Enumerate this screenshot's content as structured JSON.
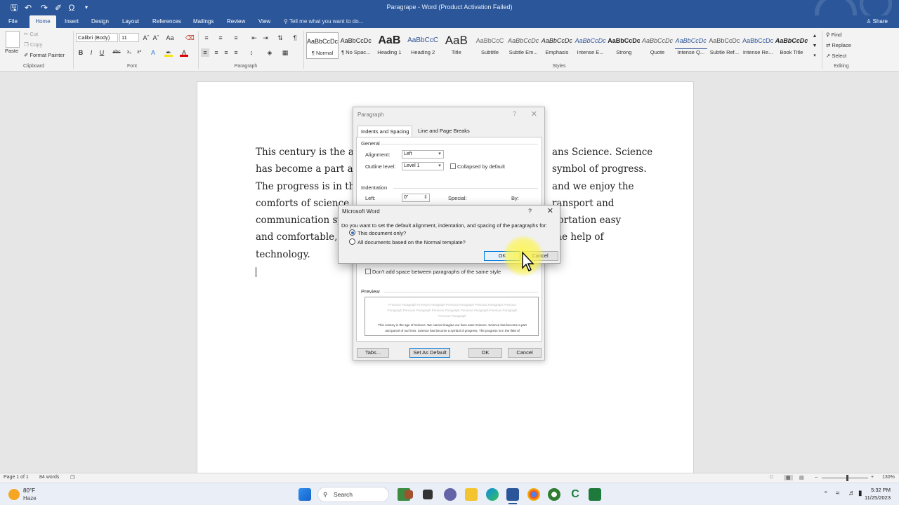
{
  "window": {
    "title": "Paragrape - Word (Product Activation Failed)"
  },
  "tabs": [
    "File",
    "Home",
    "Insert",
    "Design",
    "Layout",
    "References",
    "Mailings",
    "Review",
    "View"
  ],
  "tell_me": "Tell me what you want to do...",
  "share_label": "Share",
  "clipboard": {
    "paste": "Paste",
    "cut": "Cut",
    "copy": "Copy",
    "format_painter": "Format Painter",
    "label": "Clipboard"
  },
  "font": {
    "name": "Calibri (Body)",
    "size": "11",
    "label": "Font"
  },
  "paragraph_group_label": "Paragraph",
  "styles": {
    "label": "Styles",
    "items": [
      {
        "preview": "AaBbCcDc",
        "name": "¶ Normal"
      },
      {
        "preview": "AaBbCcDc",
        "name": "¶ No Spac..."
      },
      {
        "preview": "AaB",
        "name": "Heading 1"
      },
      {
        "preview": "AaBbCcC",
        "name": "Heading 2"
      },
      {
        "preview": "AaB",
        "name": "Title"
      },
      {
        "preview": "AaBbCcC",
        "name": "Subtitle"
      },
      {
        "preview": "AaBbCcDc",
        "name": "Subtle Em..."
      },
      {
        "preview": "AaBbCcDc",
        "name": "Emphasis"
      },
      {
        "preview": "AaBbCcDc",
        "name": "Intense E..."
      },
      {
        "preview": "AaBbCcDc",
        "name": "Strong"
      },
      {
        "preview": "AaBbCcDc",
        "name": "Quote"
      },
      {
        "preview": "AaBbCcDc",
        "name": "Intense Q..."
      },
      {
        "preview": "AaBbCcDc",
        "name": "Subtle Ref..."
      },
      {
        "preview": "AaBbCcDc",
        "name": "Intense Re..."
      },
      {
        "preview": "AaBbCcDc",
        "name": "Book Title"
      }
    ]
  },
  "editing": {
    "find": "Find",
    "replace": "Replace",
    "select": "Select",
    "label": "Editing"
  },
  "document": {
    "lines": [
      "This century is the age",
      "has become a part and",
      "The progress is in the",
      "comforts of science in",
      "communication sy",
      "and comfortable, s",
      "technology."
    ],
    "right_lines": [
      "ans Science. Science",
      "symbol of progress.",
      "and we enjoy the",
      "ransport and",
      "portation easy",
      "the help of",
      ""
    ]
  },
  "paragraph_dialog": {
    "title": "Paragraph",
    "help": "?",
    "tab_indents": "Indents and Spacing",
    "tab_breaks": "Line and Page Breaks",
    "general": "General",
    "alignment_label": "Alignment:",
    "alignment_value": "Left",
    "outline_label": "Outline level:",
    "outline_value": "Level 1",
    "collapsed_label": "Collapsed by default",
    "indentation": "Indentation",
    "left_label": "Left:",
    "left_value": "0\"",
    "special_label": "Special:",
    "by_label": "By:",
    "dont_add_space": "Don't add space between paragraphs of the same style",
    "preview_label": "Preview",
    "preview_lines": [
      "Previous Paragraph Previous Paragraph Previous Paragraph Previous Paragraph Previous",
      "Paragraph Previous Paragraph Previous Paragraph Previous Paragraph Previous Paragraph",
      "Previous Paragraph",
      "This century is the age of Science. We cannot imagine our lives sans Science. Science has become a part",
      "and parcel of our lives. Science has become a symbol of progress. The progress is in the field of"
    ],
    "tabs_button": "Tabs...",
    "set_default_button": "Set As Default",
    "ok_button": "OK",
    "cancel_button": "Cancel"
  },
  "confirm_dialog": {
    "title": "Microsoft Word",
    "help": "?",
    "question": "Do you want to set the default alignment, indentation, and spacing of the paragraphs for:",
    "option_this": "This document only?",
    "option_all": "All documents based on the Normal template?",
    "ok": "OK",
    "cancel": "Cancel"
  },
  "status_bar": {
    "page": "Page 1 of 1",
    "words": "84 words",
    "zoom": "130%"
  },
  "taskbar": {
    "weather_temp": "80°F",
    "weather_desc": "Haze",
    "search": "Search",
    "time": "5:32 PM",
    "date": "11/25/2023"
  },
  "colors": {
    "word_blue": "#2b579a",
    "accent": "#0078d7",
    "highlight": "#fff53c"
  }
}
